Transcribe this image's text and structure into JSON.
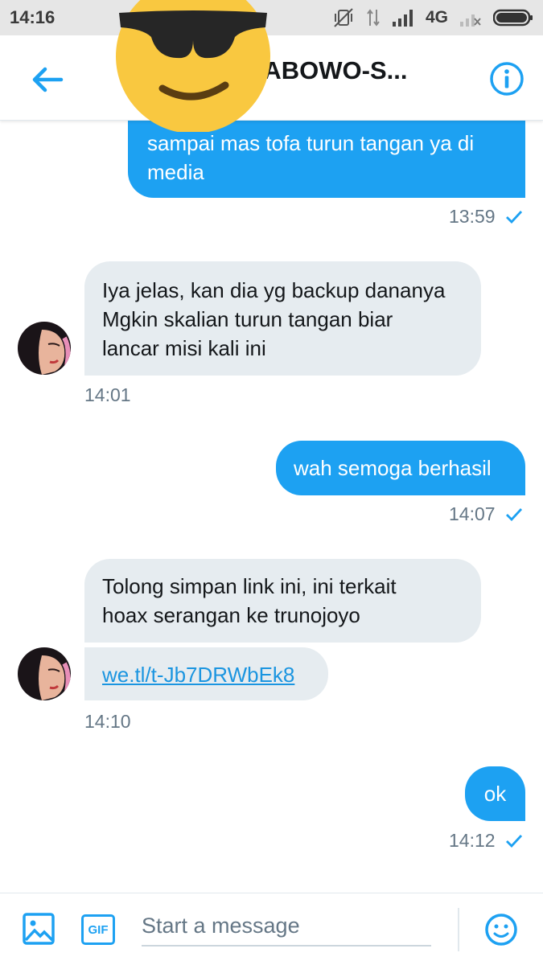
{
  "status_bar": {
    "time": "14:16",
    "network": "4G",
    "icons": [
      "muted-vibrate-icon",
      "data-arrows-icon",
      "signal-icon",
      "network-4g-icon",
      "signal-empty-icon",
      "battery-icon"
    ]
  },
  "header": {
    "title": "RABOWO-S...",
    "back_icon": "arrow-left-icon",
    "info_icon": "info-circle-icon",
    "overlay": "sunglasses-emoji-sticker"
  },
  "colors": {
    "accent": "#1da1f2",
    "incoming_bubble": "#e6ecf0",
    "timestamp": "#657786"
  },
  "messages": [
    {
      "direction": "outgoing",
      "lines": [
        "sampai mas tofa turun tangan ya di",
        "media"
      ],
      "time": "13:59",
      "read_icon": "check-icon"
    },
    {
      "direction": "incoming",
      "lines": [
        "Iya jelas, kan dia yg backup dananya",
        "Mgkin skalian turun tangan biar",
        "lancar misi kali ini"
      ],
      "time": "14:01"
    },
    {
      "direction": "outgoing",
      "lines": [
        "wah semoga berhasil"
      ],
      "time": "14:07",
      "read_icon": "check-icon"
    },
    {
      "direction": "incoming",
      "lines": [
        "Tolong simpan link ini, ini terkait",
        "hoax serangan ke trunojoyo"
      ]
    },
    {
      "direction": "incoming",
      "link": "we.tl/t-Jb7DRWbEk8",
      "time": "14:10"
    },
    {
      "direction": "outgoing",
      "lines": [
        "ok"
      ],
      "time": "14:12",
      "read_icon": "check-icon"
    }
  ],
  "composer": {
    "placeholder": "Start a message",
    "gif_label": "GIF",
    "image_icon": "image-icon",
    "emoji_icon": "smiley-icon"
  }
}
